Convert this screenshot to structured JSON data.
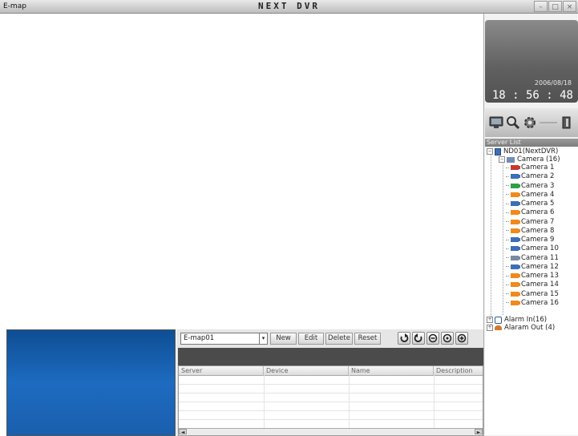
{
  "window": {
    "app_name": "E-map",
    "title": "NEXT DVR",
    "buttons": [
      "–",
      "□",
      "×"
    ]
  },
  "clock": {
    "date": "2006/08/18",
    "time": "18 : 56 : 48"
  },
  "toolbar_icons": [
    "monitor-icon",
    "search-icon",
    "gear-icon",
    "exit-icon"
  ],
  "server_list": {
    "header": "Server List",
    "root": "ND01(NextDVR)",
    "camera_group": "Camera (16)",
    "cameras": [
      {
        "label": "Camera 1",
        "color": "#c83a2a"
      },
      {
        "label": "Camera 2",
        "color": "#3d6fb8"
      },
      {
        "label": "Camera 3",
        "color": "#2fa04a"
      },
      {
        "label": "Camera 4",
        "color": "#f08a1c"
      },
      {
        "label": "Camera 5",
        "color": "#3d6fb8"
      },
      {
        "label": "Camera 6",
        "color": "#f08a1c"
      },
      {
        "label": "Camera 7",
        "color": "#f08a1c"
      },
      {
        "label": "Camera 8",
        "color": "#f08a1c"
      },
      {
        "label": "Camera 9",
        "color": "#3d6fb8"
      },
      {
        "label": "Camera 10",
        "color": "#3d6fb8"
      },
      {
        "label": "Camera 11",
        "color": "#7a8aa0"
      },
      {
        "label": "Camera 12",
        "color": "#3d6fb8"
      },
      {
        "label": "Camera 13",
        "color": "#f08a1c"
      },
      {
        "label": "Camera 14",
        "color": "#f08a1c"
      },
      {
        "label": "Camera 15",
        "color": "#f08a1c"
      },
      {
        "label": "Camera 16",
        "color": "#f08a1c"
      }
    ],
    "alarm_in": "Alarm In(16)",
    "alarm_out": "Alaram Out (4)"
  },
  "emap": {
    "selected_map": "E-map01",
    "dropdown_arrow": "▾",
    "buttons": {
      "new": "New",
      "edit": "Edit",
      "delete": "Delete",
      "reset": "Reset"
    },
    "nav_icons": [
      "rotate-cw-icon",
      "rotate-ccw-icon",
      "zoom-out-icon",
      "zoom-fit-icon",
      "zoom-in-icon"
    ]
  },
  "grid": {
    "columns": [
      "Server",
      "Device",
      "Name",
      "Description"
    ],
    "scroll_left": "◄",
    "scroll_right": "►"
  }
}
